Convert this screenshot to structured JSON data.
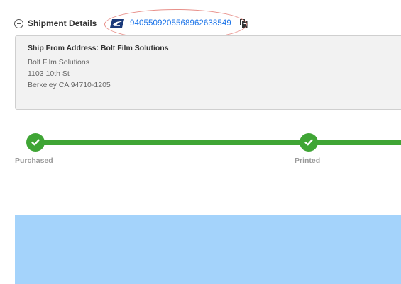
{
  "shipment": {
    "section_title": "Shipment Details",
    "carrier_icon": "usps-eagle-icon",
    "tracking_number": "9405509205568962638549",
    "copy_icon": "clipboard-copy-icon",
    "highlight_color": "#e8908a"
  },
  "ship_from": {
    "heading": "Ship From Address: Bolt Film Solutions",
    "lines": [
      "Bolt Film Solutions",
      "1103 10th St",
      "Berkeley CA 94710-1205"
    ]
  },
  "progress": {
    "color": "#3fa535",
    "steps": [
      {
        "label": "Purchased",
        "status": "complete"
      },
      {
        "label": "Printed",
        "status": "complete"
      }
    ]
  },
  "colors": {
    "link": "#1a73e8",
    "panel_blue": "#a4d3fb",
    "card_bg": "#f2f2f2"
  }
}
